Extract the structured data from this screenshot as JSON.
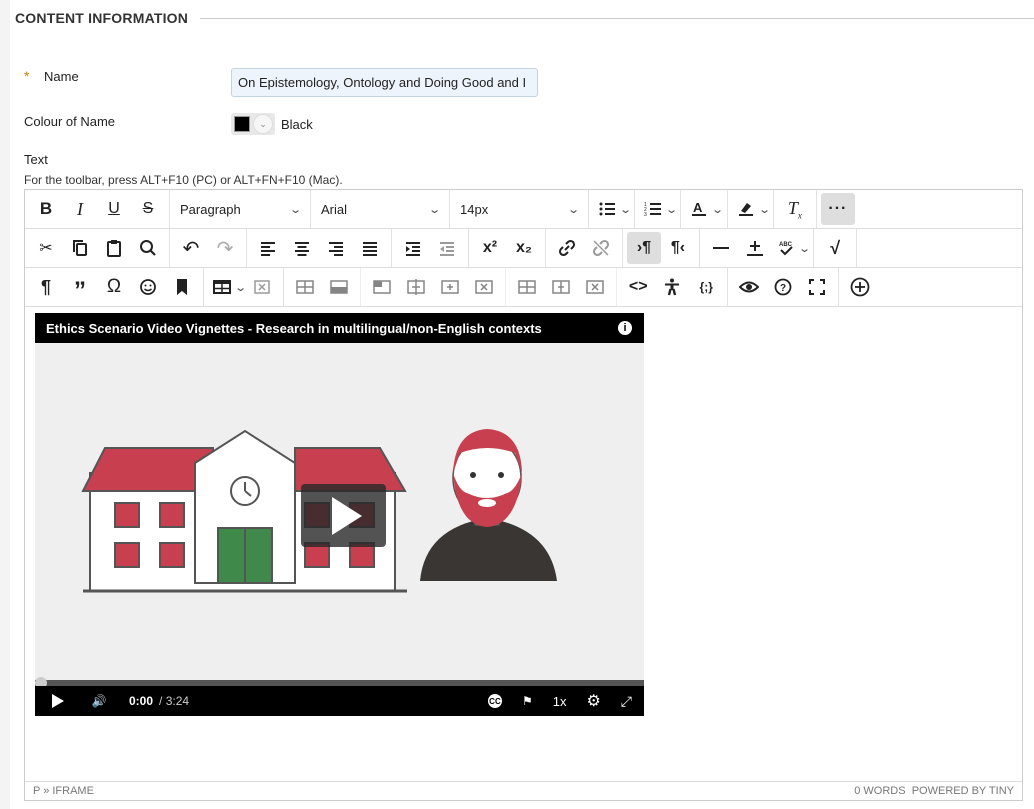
{
  "section": {
    "title": "CONTENT INFORMATION"
  },
  "name_field": {
    "required_mark": "*",
    "label": "Name",
    "value": "On Epistemology, Ontology and Doing Good and I"
  },
  "colour_field": {
    "label": "Colour of Name",
    "value": "Black",
    "swatch_color": "#000000"
  },
  "text_field": {
    "label": "Text",
    "help": "For the toolbar, press ALT+F10 (PC) or ALT+FN+F10 (Mac)."
  },
  "toolbar": {
    "block_format": "Paragraph",
    "font_family": "Arial",
    "font_size": "14px",
    "sup_label": "x²",
    "sub_label": "x₂",
    "spell_label": "ABC",
    "code_label": "{;}"
  },
  "video": {
    "title": "Ethics Scenario Video Vignettes - Research in multilingual/non-English contexts",
    "time_current": "0:00",
    "time_total": "/ 3:24",
    "speed": "1x",
    "progress": 0,
    "colors": {
      "roof": "#c8404f",
      "door": "#3f8a4b",
      "beard": "#c8404f",
      "shirt": "#3a3633"
    }
  },
  "statusbar": {
    "path": "P » IFRAME",
    "word_count": "0 WORDS",
    "powered": "POWERED BY TINY"
  }
}
